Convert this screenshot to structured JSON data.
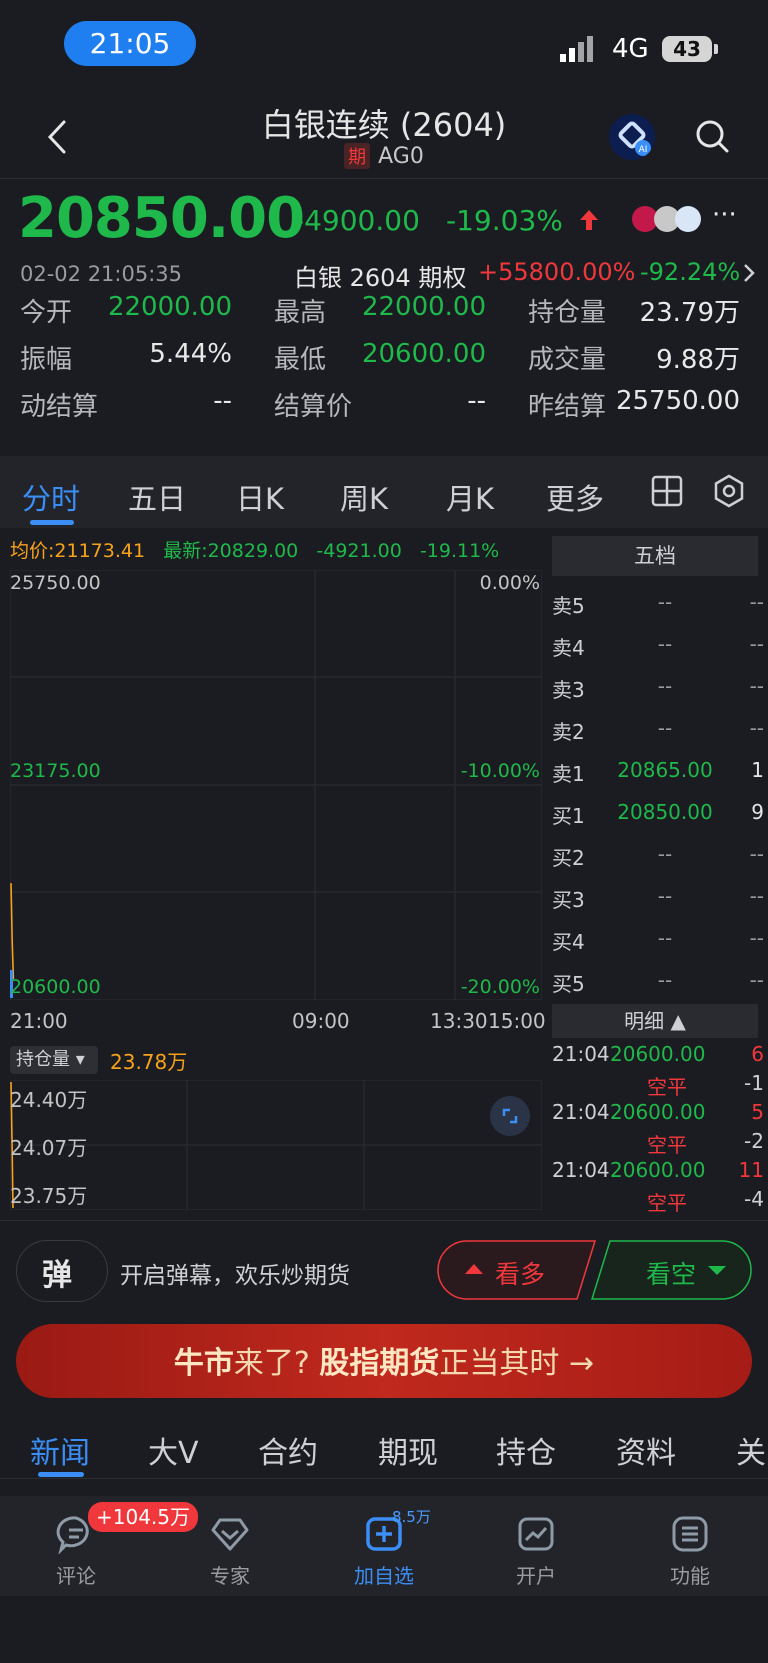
{
  "status": {
    "time": "21:05",
    "network": "4G",
    "battery": "43"
  },
  "header": {
    "title": "白银连续 (2604)",
    "tag": "期",
    "code": "AG0"
  },
  "quote": {
    "price": "20850.00",
    "change": "-4900.00",
    "change_pct": "-19.03%",
    "datetime": "02-02 21:05:35",
    "option_label": "白银 2604 期权",
    "option_change": "+55800.00%",
    "option_pct": "-92.24%"
  },
  "stats": [
    {
      "label": "今开",
      "value": "22000.00",
      "color": "#1fb84a"
    },
    {
      "label": "最高",
      "value": "22000.00",
      "color": "#1fb84a"
    },
    {
      "label": "持仓量",
      "value": "23.79万",
      "color": "#e9e9ea"
    },
    {
      "label": "振幅",
      "value": "5.44%",
      "color": "#e9e9ea"
    },
    {
      "label": "最低",
      "value": "20600.00",
      "color": "#1fb84a"
    },
    {
      "label": "成交量",
      "value": "9.88万",
      "color": "#e9e9ea"
    },
    {
      "label": "动结算",
      "value": "--",
      "color": "#e9e9ea"
    },
    {
      "label": "结算价",
      "value": "--",
      "color": "#e9e9ea"
    },
    {
      "label": "昨结算",
      "value": "25750.00",
      "color": "#e9e9ea"
    }
  ],
  "tabs": [
    "分时",
    "五日",
    "日K",
    "周K",
    "月K",
    "更多"
  ],
  "chart": {
    "avg_label": "均价:21173.41",
    "latest_label": "最新:20829.00",
    "latest_change": "-4921.00",
    "latest_pct": "-19.11%",
    "y_left": [
      "25750.00",
      "23175.00",
      "20600.00"
    ],
    "y_right": [
      "0.00%",
      "-10.00%",
      "-20.00%"
    ],
    "x_labels": [
      "21:00",
      "09:00",
      "13:30",
      "15:00"
    ]
  },
  "chart_data": {
    "type": "line",
    "title": "",
    "xlabel": "",
    "ylabel": "",
    "ylim": [
      20600,
      25750
    ],
    "series": [
      {
        "values": [
          22000,
          21300,
          20850
        ]
      }
    ]
  },
  "orderbook": {
    "title": "五档",
    "rows": [
      {
        "label": "卖5",
        "price": "--",
        "vol": "--"
      },
      {
        "label": "卖4",
        "price": "--",
        "vol": "--"
      },
      {
        "label": "卖3",
        "price": "--",
        "vol": "--"
      },
      {
        "label": "卖2",
        "price": "--",
        "vol": "--"
      },
      {
        "label": "卖1",
        "price": "20865.00",
        "vol": "1"
      },
      {
        "label": "买1",
        "price": "20850.00",
        "vol": "9"
      },
      {
        "label": "买2",
        "price": "--",
        "vol": "--"
      },
      {
        "label": "买3",
        "price": "--",
        "vol": "--"
      },
      {
        "label": "买4",
        "price": "--",
        "vol": "--"
      },
      {
        "label": "买5",
        "price": "--",
        "vol": "--"
      }
    ]
  },
  "detail": {
    "title": "明细",
    "trades": [
      {
        "time": "21:04",
        "price": "20600.00",
        "vol": "6",
        "kind": "空平",
        "delta": "-1"
      },
      {
        "time": "21:04",
        "price": "20600.00",
        "vol": "5",
        "kind": "空平",
        "delta": "-2"
      },
      {
        "time": "21:04",
        "price": "20600.00",
        "vol": "11",
        "kind": "空平",
        "delta": "-4"
      }
    ]
  },
  "oi": {
    "select": "持仓量",
    "value": "23.78万",
    "y_labels": [
      "24.40万",
      "24.07万",
      "23.75万"
    ]
  },
  "danmu": {
    "glyph": "弹",
    "text": "开启弹幕，欢乐炒期货"
  },
  "actions": {
    "long": "看多",
    "short": "看空"
  },
  "banner": {
    "part1": "牛市",
    "part2": "来了?",
    "part3": "股指期货",
    "part4": "正当其时"
  },
  "news_tabs": [
    "新闻",
    "大V",
    "合约",
    "期现",
    "持仓",
    "资料",
    "关"
  ],
  "nav": {
    "comment": "评论",
    "comment_badge": "+104.5万",
    "expert": "专家",
    "fav": "加自选",
    "fav_count": "8.5万",
    "account": "开户",
    "func": "功能"
  },
  "colors": {
    "green": "#1fb84a",
    "red": "#f0383c",
    "accent": "#3a8ef5",
    "avg": "#f7a21b"
  }
}
